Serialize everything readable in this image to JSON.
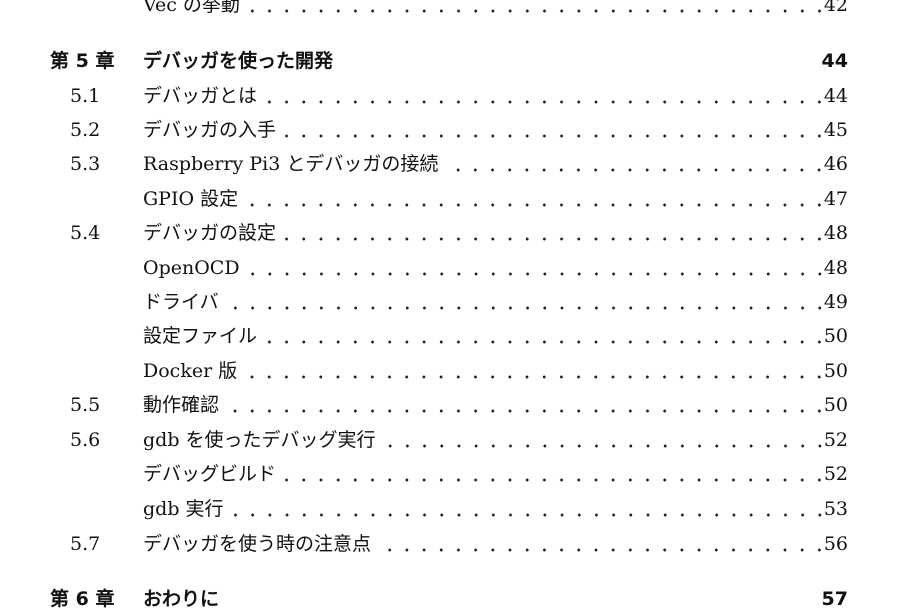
{
  "toc": {
    "top_entry": {
      "title": "Vec の挙動",
      "page": "42"
    },
    "chapter5": {
      "label": "第 5 章",
      "title": "デバッガを使った開発",
      "page": "44"
    },
    "entries": [
      {
        "num": "5.1",
        "title": "デバッガとは",
        "page": "44"
      },
      {
        "num": "5.2",
        "title": "デバッガの入手",
        "page": "45"
      },
      {
        "num": "5.3",
        "title": "Raspberry Pi3 とデバッガの接続",
        "page": "46"
      },
      {
        "num": "",
        "title": "GPIO 設定",
        "page": "47"
      },
      {
        "num": "5.4",
        "title": "デバッガの設定",
        "page": "48"
      },
      {
        "num": "",
        "title": "OpenOCD",
        "page": "48"
      },
      {
        "num": "",
        "title": "ドライバ",
        "page": "49"
      },
      {
        "num": "",
        "title": "設定ファイル",
        "page": "50"
      },
      {
        "num": "",
        "title": "Docker 版",
        "page": "50"
      },
      {
        "num": "5.5",
        "title": "動作確認",
        "page": "50"
      },
      {
        "num": "5.6",
        "title": "gdb を使ったデバッグ実行",
        "page": "52"
      },
      {
        "num": "",
        "title": "デバッグビルド",
        "page": "52"
      },
      {
        "num": "",
        "title": "gdb 実行",
        "page": "53"
      },
      {
        "num": "5.7",
        "title": "デバッガを使う時の注意点",
        "page": "56"
      }
    ],
    "chapter6": {
      "label": "第 6 章",
      "title": "おわりに",
      "page": "57"
    }
  }
}
